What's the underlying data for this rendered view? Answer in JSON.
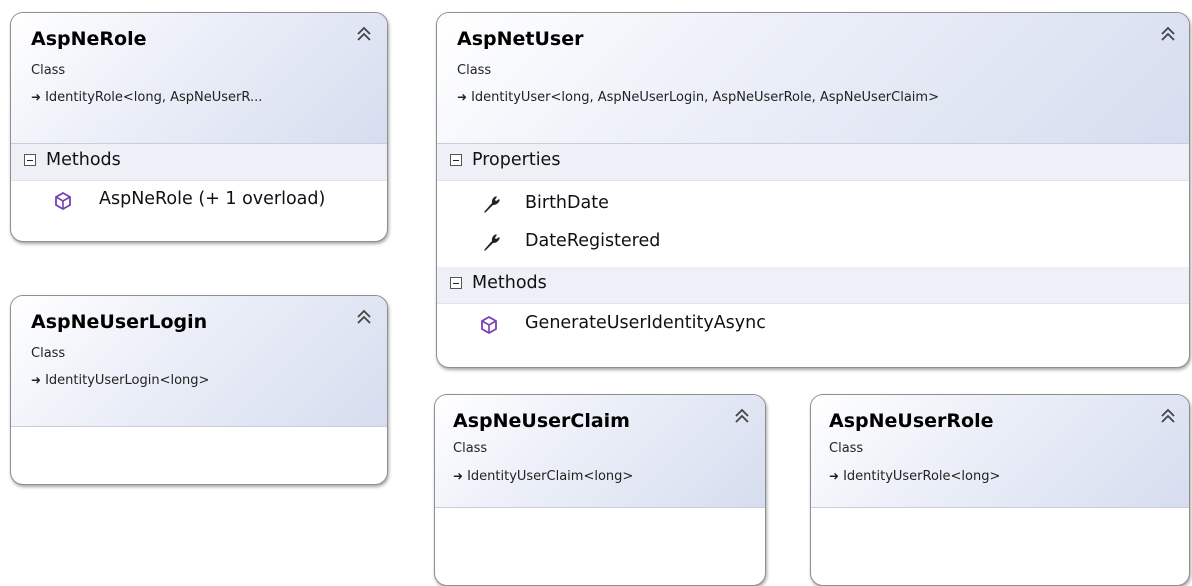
{
  "diagram": {
    "role": {
      "title": "AspNeRole",
      "kind": "Class",
      "base": "IdentityRole<long, AspNeUserR...",
      "methods_label": "Methods",
      "methods": [
        "AspNeRole (+ 1 overload)"
      ]
    },
    "user": {
      "title": "AspNetUser",
      "kind": "Class",
      "base": "IdentityUser<long,  AspNeUserLogin,  AspNeUserRole,  AspNeUserClaim>",
      "properties_label": "Properties",
      "properties": [
        "BirthDate",
        "DateRegistered"
      ],
      "methods_label": "Methods",
      "methods": [
        "GenerateUserIdentityAsync"
      ]
    },
    "login": {
      "title": "AspNeUserLogin",
      "kind": "Class",
      "base": "IdentityUserLogin<long>"
    },
    "claim": {
      "title": "AspNeUserClaim",
      "kind": "Class",
      "base": "IdentityUserClaim<long>"
    },
    "userrole": {
      "title": "AspNeUserRole",
      "kind": "Class",
      "base": "IdentityUserRole<long>"
    }
  }
}
